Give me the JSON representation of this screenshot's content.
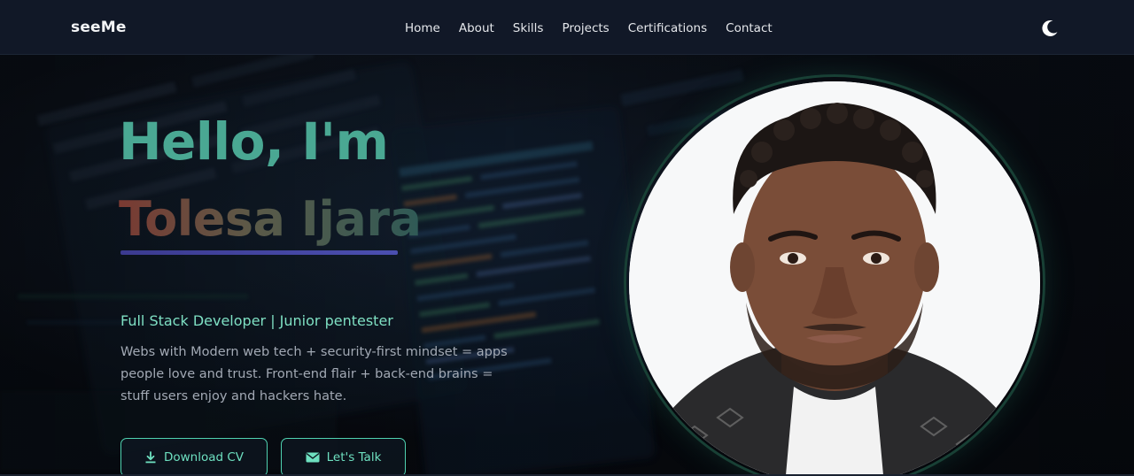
{
  "nav": {
    "brand": "seeMe",
    "links": [
      "Home",
      "About",
      "Skills",
      "Projects",
      "Certifications",
      "Contact"
    ]
  },
  "hero": {
    "greeting": "Hello, I'm",
    "name": "Tolesa Ijara",
    "role": "Full Stack Developer | Junior pentester",
    "description": "Webs with Modern web tech + security-first mindset = apps people love and trust. Front-end flair + back-end brains = stuff users enjoy and hackers hate.",
    "buttons": {
      "download_cv": "Download CV",
      "lets_talk": "Let's Talk"
    }
  },
  "icons": {
    "theme_toggle": "moon-icon",
    "download": "download-icon",
    "talk": "envelope-icon"
  },
  "colors": {
    "nav_bg": "#111827",
    "accent": "#4fd1b0",
    "greeting": "#4aa893",
    "underline": "#4b4fb0"
  }
}
